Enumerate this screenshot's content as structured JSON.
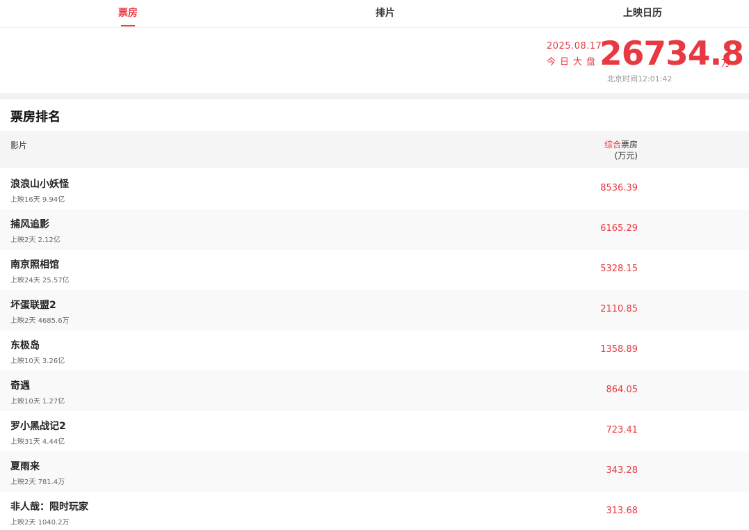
{
  "tabs": [
    {
      "label": "票房",
      "active": true
    },
    {
      "label": "排片",
      "active": false
    },
    {
      "label": "上映日历",
      "active": false
    }
  ],
  "summary": {
    "date": "2025.08.17",
    "label": "今日大盘",
    "value": "26734.8",
    "unit": "万",
    "time": "北京时间12:01:42"
  },
  "section_title": "票房排名",
  "table": {
    "col_film": "影片",
    "col_box_highlight": "综合",
    "col_box_rest": "票房",
    "col_box_unit": "(万元)",
    "rows": [
      {
        "name": "浪浪山小妖怪",
        "days": "上映16天",
        "total": "9.94亿",
        "box": "8536.39"
      },
      {
        "name": "捕风追影",
        "days": "上映2天",
        "total": "2.12亿",
        "box": "6165.29"
      },
      {
        "name": "南京照相馆",
        "days": "上映24天",
        "total": "25.57亿",
        "box": "5328.15"
      },
      {
        "name": "坏蛋联盟2",
        "days": "上映2天",
        "total": "4685.6万",
        "box": "2110.85"
      },
      {
        "name": "东极岛",
        "days": "上映10天",
        "total": "3.26亿",
        "box": "1358.89"
      },
      {
        "name": "奇遇",
        "days": "上映10天",
        "total": "1.27亿",
        "box": "864.05"
      },
      {
        "name": "罗小黑战记2",
        "days": "上映31天",
        "total": "4.44亿",
        "box": "723.41"
      },
      {
        "name": "夏雨来",
        "days": "上映2天",
        "total": "781.4万",
        "box": "343.28"
      },
      {
        "name": "非人哉：限时玩家",
        "days": "上映2天",
        "total": "1040.2万",
        "box": "313.68"
      }
    ]
  }
}
